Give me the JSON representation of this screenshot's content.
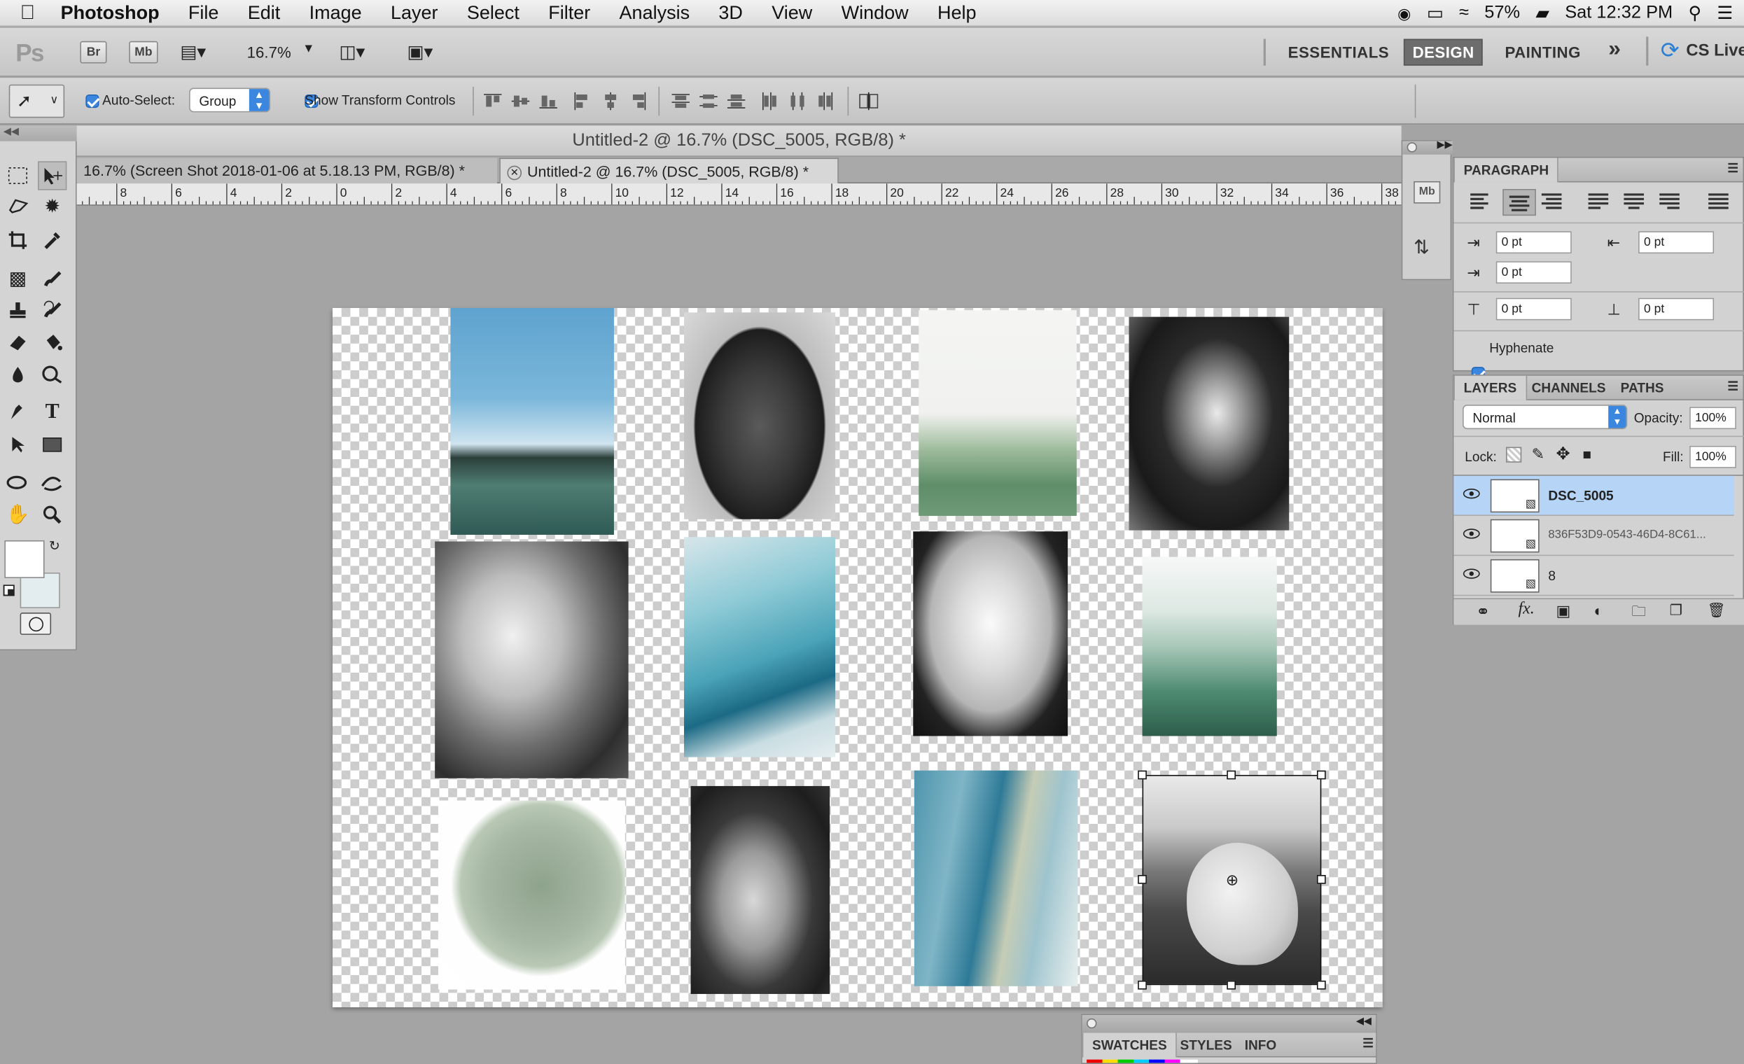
{
  "menubar": {
    "app": "Photoshop",
    "items": [
      "File",
      "Edit",
      "Image",
      "Layer",
      "Select",
      "Filter",
      "Analysis",
      "3D",
      "View",
      "Window",
      "Help"
    ],
    "battery": "57%",
    "clock": "Sat 12:32 PM"
  },
  "appbar": {
    "logo": "Ps",
    "br": "Br",
    "mb": "Mb",
    "zoom": "16.7%",
    "workspaces": [
      "ESSENTIALS",
      "DESIGN",
      "PAINTING"
    ],
    "more": "»",
    "cs_live": "CS Live"
  },
  "options": {
    "auto_select_label": "Auto-Select:",
    "auto_select_value": "Group",
    "show_transform": "Show Transform Controls"
  },
  "document": {
    "title": "Untitled-2 @ 16.7% (DSC_5005, RGB/8) *",
    "tabs": [
      "16.7% (Screen Shot 2018-01-06 at 5.18.13 PM, RGB/8) *",
      "Untitled-2 @ 16.7% (DSC_5005, RGB/8) *"
    ],
    "ruler_labels": [
      "8",
      "6",
      "4",
      "2",
      "0",
      "2",
      "4",
      "6",
      "8",
      "10",
      "12",
      "14",
      "16",
      "18",
      "20",
      "22",
      "24",
      "26",
      "28",
      "30",
      "32",
      "34",
      "36",
      "38"
    ]
  },
  "paragraph": {
    "title": "PARAGRAPH",
    "indent_left": "0 pt",
    "indent_right": "0 pt",
    "indent_first": "0 pt",
    "space_before": "0 pt",
    "space_after": "0 pt",
    "hyphenate": "Hyphenate"
  },
  "layers": {
    "tabs": [
      "LAYERS",
      "CHANNELS",
      "PATHS"
    ],
    "blend": "Normal",
    "opacity_label": "Opacity:",
    "opacity": "100%",
    "lock_label": "Lock:",
    "fill_label": "Fill:",
    "fill": "100%",
    "rows": [
      {
        "name": "DSC_5005",
        "selected": true
      },
      {
        "name": "836F53D9-0543-46D4-8C61..."
      },
      {
        "name": "8"
      }
    ]
  },
  "swatches": {
    "tabs": [
      "SWATCHES",
      "STYLES",
      "INFO"
    ]
  },
  "mini_panel": {
    "mb": "Mb"
  }
}
